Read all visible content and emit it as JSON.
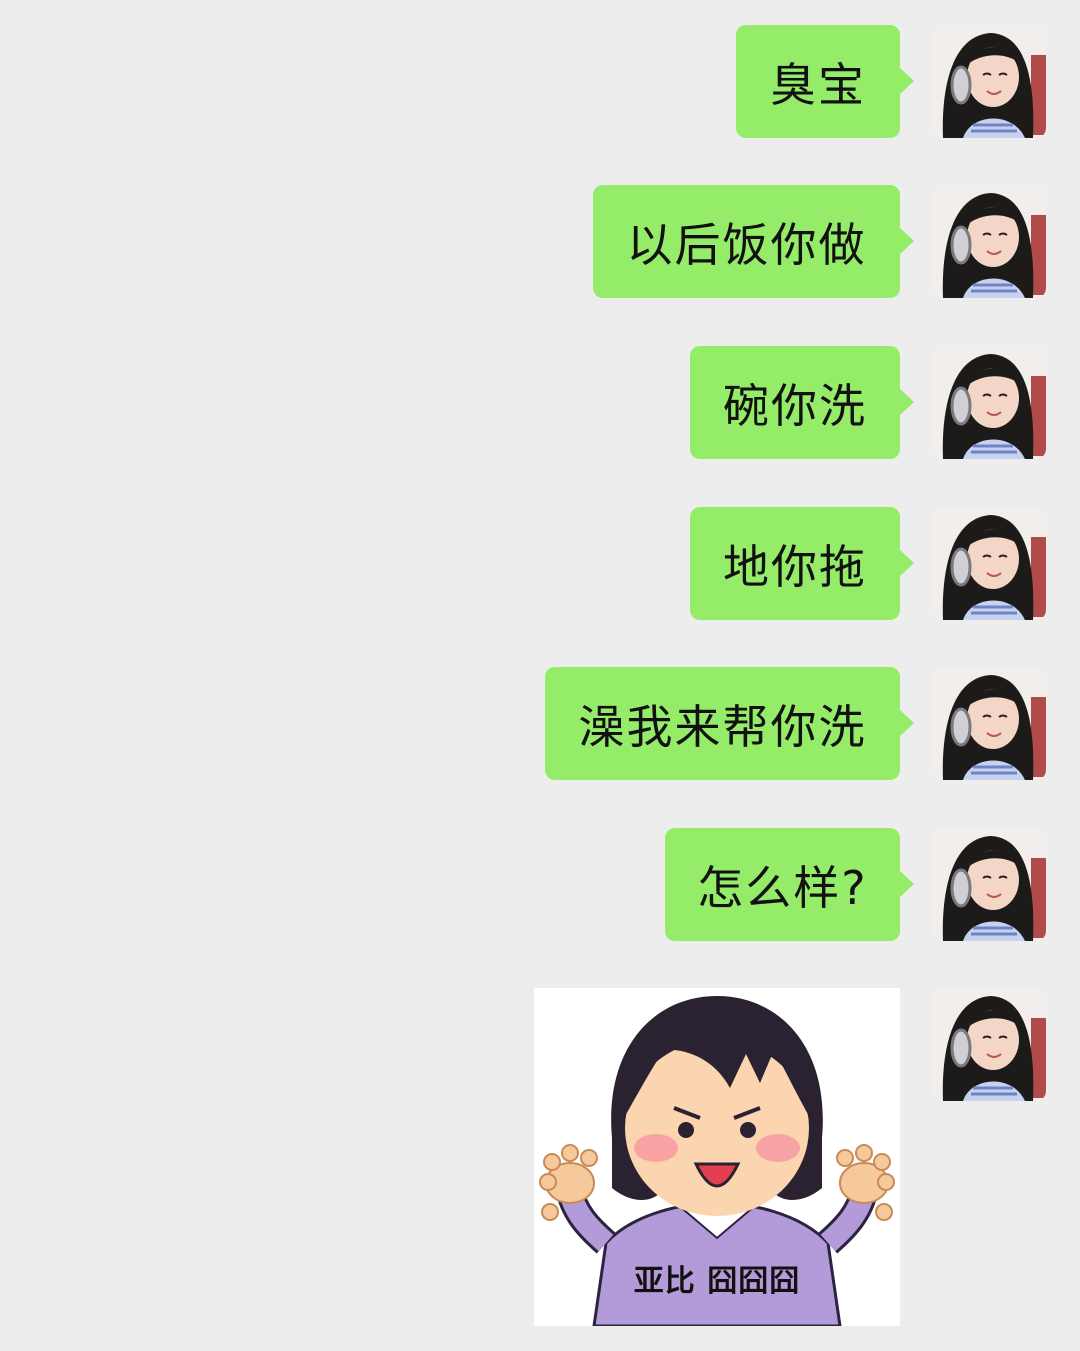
{
  "messages": [
    {
      "sender": "me",
      "type": "text",
      "text": "臭宝"
    },
    {
      "sender": "me",
      "type": "text",
      "text": "以后饭你做"
    },
    {
      "sender": "me",
      "type": "text",
      "text": "碗你洗"
    },
    {
      "sender": "me",
      "type": "text",
      "text": "地你拖"
    },
    {
      "sender": "me",
      "type": "text",
      "text": "澡我来帮你洗"
    },
    {
      "sender": "me",
      "type": "text",
      "text": "怎么样?"
    },
    {
      "sender": "me",
      "type": "sticker",
      "caption": "亚比 囧囧囧",
      "icon": "girl-claws-sticker"
    }
  ],
  "colors": {
    "background": "#ededed",
    "my_bubble": "#95ec69",
    "text": "#111111"
  }
}
